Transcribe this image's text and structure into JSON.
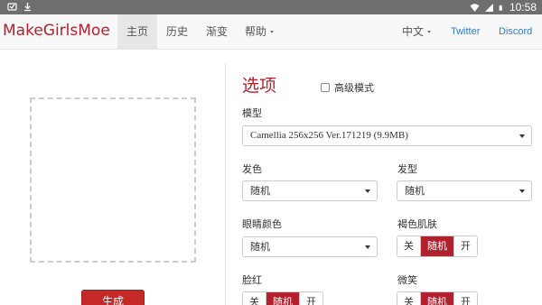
{
  "status_bar": {
    "time": "10:58"
  },
  "navbar": {
    "brand": "MakeGirlsMoe",
    "items": [
      {
        "label": "主页",
        "active": true
      },
      {
        "label": "历史",
        "active": false
      },
      {
        "label": "渐变",
        "active": false
      },
      {
        "label": "帮助",
        "active": false
      }
    ],
    "language": "中文",
    "links": [
      "Twitter",
      "Discord"
    ]
  },
  "left": {
    "generate_label": "生成"
  },
  "options": {
    "title": "选项",
    "advanced_label": "高级模式",
    "model_label": "模型",
    "model_value": "Camellia 256x256 Ver.171219 (9.9MB)",
    "hair_color_label": "发色",
    "hair_color_value": "随机",
    "hair_style_label": "发型",
    "hair_style_value": "随机",
    "eye_color_label": "眼睛颜色",
    "eye_color_value": "随机",
    "dark_skin_label": "褐色肌肤",
    "blush_label": "脸红",
    "smile_label": "微笑",
    "toggle": {
      "off": "关",
      "random": "随机",
      "on": "开"
    }
  },
  "colors": {
    "accent": "#b21f2d",
    "link": "#337ab7"
  }
}
